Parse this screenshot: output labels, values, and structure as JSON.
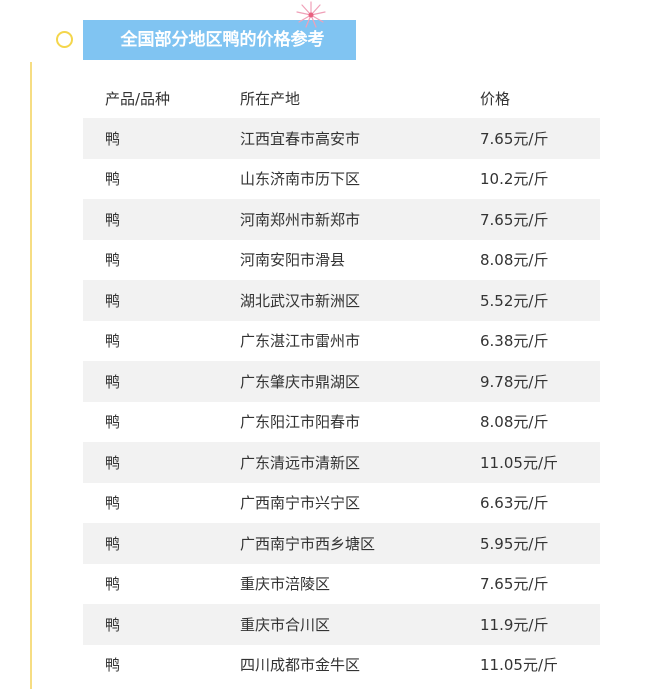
{
  "title": "全国部分地区鸭的价格参考",
  "colors": {
    "banner": "#80c4f2",
    "timeline": "#f6dd83",
    "row_shade": "#f2f2f2"
  },
  "icons": {
    "marker": "timeline-circle-icon",
    "decoration": "firework-icon"
  },
  "table": {
    "headers": [
      "产品/品种",
      "所在产地",
      "价格"
    ],
    "rows": [
      [
        "鸭",
        "江西宜春市高安市",
        "7.65元/斤"
      ],
      [
        "鸭",
        "山东济南市历下区",
        "10.2元/斤"
      ],
      [
        "鸭",
        "河南郑州市新郑市",
        "7.65元/斤"
      ],
      [
        "鸭",
        "河南安阳市滑县",
        "8.08元/斤"
      ],
      [
        "鸭",
        "湖北武汉市新洲区",
        "5.52元/斤"
      ],
      [
        "鸭",
        "广东湛江市雷州市",
        "6.38元/斤"
      ],
      [
        "鸭",
        "广东肇庆市鼎湖区",
        "9.78元/斤"
      ],
      [
        "鸭",
        "广东阳江市阳春市",
        "8.08元/斤"
      ],
      [
        "鸭",
        "广东清远市清新区",
        "11.05元/斤"
      ],
      [
        "鸭",
        "广西南宁市兴宁区",
        "6.63元/斤"
      ],
      [
        "鸭",
        "广西南宁市西乡塘区",
        "5.95元/斤"
      ],
      [
        "鸭",
        "重庆市涪陵区",
        "7.65元/斤"
      ],
      [
        "鸭",
        "重庆市合川区",
        "11.9元/斤"
      ],
      [
        "鸭",
        "四川成都市金牛区",
        "11.05元/斤"
      ]
    ]
  }
}
